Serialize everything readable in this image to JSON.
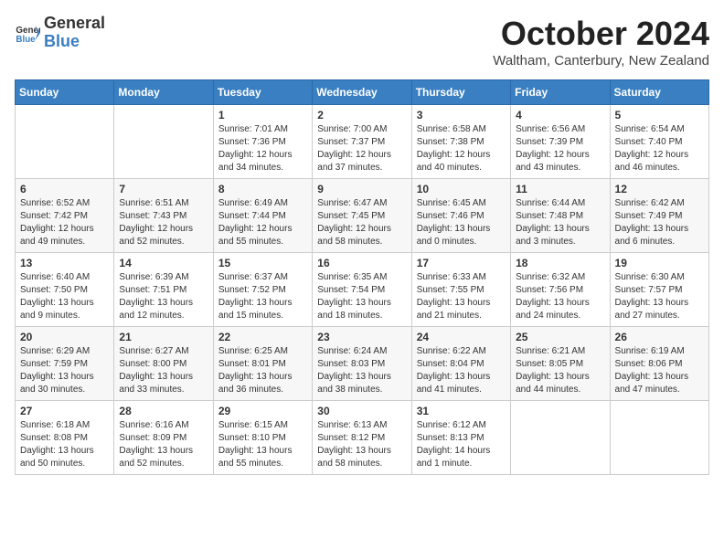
{
  "header": {
    "logo_general": "General",
    "logo_blue": "Blue",
    "month_title": "October 2024",
    "location": "Waltham, Canterbury, New Zealand"
  },
  "weekdays": [
    "Sunday",
    "Monday",
    "Tuesday",
    "Wednesday",
    "Thursday",
    "Friday",
    "Saturday"
  ],
  "weeks": [
    [
      {
        "day": "",
        "info": ""
      },
      {
        "day": "",
        "info": ""
      },
      {
        "day": "1",
        "info": "Sunrise: 7:01 AM\nSunset: 7:36 PM\nDaylight: 12 hours\nand 34 minutes."
      },
      {
        "day": "2",
        "info": "Sunrise: 7:00 AM\nSunset: 7:37 PM\nDaylight: 12 hours\nand 37 minutes."
      },
      {
        "day": "3",
        "info": "Sunrise: 6:58 AM\nSunset: 7:38 PM\nDaylight: 12 hours\nand 40 minutes."
      },
      {
        "day": "4",
        "info": "Sunrise: 6:56 AM\nSunset: 7:39 PM\nDaylight: 12 hours\nand 43 minutes."
      },
      {
        "day": "5",
        "info": "Sunrise: 6:54 AM\nSunset: 7:40 PM\nDaylight: 12 hours\nand 46 minutes."
      }
    ],
    [
      {
        "day": "6",
        "info": "Sunrise: 6:52 AM\nSunset: 7:42 PM\nDaylight: 12 hours\nand 49 minutes."
      },
      {
        "day": "7",
        "info": "Sunrise: 6:51 AM\nSunset: 7:43 PM\nDaylight: 12 hours\nand 52 minutes."
      },
      {
        "day": "8",
        "info": "Sunrise: 6:49 AM\nSunset: 7:44 PM\nDaylight: 12 hours\nand 55 minutes."
      },
      {
        "day": "9",
        "info": "Sunrise: 6:47 AM\nSunset: 7:45 PM\nDaylight: 12 hours\nand 58 minutes."
      },
      {
        "day": "10",
        "info": "Sunrise: 6:45 AM\nSunset: 7:46 PM\nDaylight: 13 hours\nand 0 minutes."
      },
      {
        "day": "11",
        "info": "Sunrise: 6:44 AM\nSunset: 7:48 PM\nDaylight: 13 hours\nand 3 minutes."
      },
      {
        "day": "12",
        "info": "Sunrise: 6:42 AM\nSunset: 7:49 PM\nDaylight: 13 hours\nand 6 minutes."
      }
    ],
    [
      {
        "day": "13",
        "info": "Sunrise: 6:40 AM\nSunset: 7:50 PM\nDaylight: 13 hours\nand 9 minutes."
      },
      {
        "day": "14",
        "info": "Sunrise: 6:39 AM\nSunset: 7:51 PM\nDaylight: 13 hours\nand 12 minutes."
      },
      {
        "day": "15",
        "info": "Sunrise: 6:37 AM\nSunset: 7:52 PM\nDaylight: 13 hours\nand 15 minutes."
      },
      {
        "day": "16",
        "info": "Sunrise: 6:35 AM\nSunset: 7:54 PM\nDaylight: 13 hours\nand 18 minutes."
      },
      {
        "day": "17",
        "info": "Sunrise: 6:33 AM\nSunset: 7:55 PM\nDaylight: 13 hours\nand 21 minutes."
      },
      {
        "day": "18",
        "info": "Sunrise: 6:32 AM\nSunset: 7:56 PM\nDaylight: 13 hours\nand 24 minutes."
      },
      {
        "day": "19",
        "info": "Sunrise: 6:30 AM\nSunset: 7:57 PM\nDaylight: 13 hours\nand 27 minutes."
      }
    ],
    [
      {
        "day": "20",
        "info": "Sunrise: 6:29 AM\nSunset: 7:59 PM\nDaylight: 13 hours\nand 30 minutes."
      },
      {
        "day": "21",
        "info": "Sunrise: 6:27 AM\nSunset: 8:00 PM\nDaylight: 13 hours\nand 33 minutes."
      },
      {
        "day": "22",
        "info": "Sunrise: 6:25 AM\nSunset: 8:01 PM\nDaylight: 13 hours\nand 36 minutes."
      },
      {
        "day": "23",
        "info": "Sunrise: 6:24 AM\nSunset: 8:03 PM\nDaylight: 13 hours\nand 38 minutes."
      },
      {
        "day": "24",
        "info": "Sunrise: 6:22 AM\nSunset: 8:04 PM\nDaylight: 13 hours\nand 41 minutes."
      },
      {
        "day": "25",
        "info": "Sunrise: 6:21 AM\nSunset: 8:05 PM\nDaylight: 13 hours\nand 44 minutes."
      },
      {
        "day": "26",
        "info": "Sunrise: 6:19 AM\nSunset: 8:06 PM\nDaylight: 13 hours\nand 47 minutes."
      }
    ],
    [
      {
        "day": "27",
        "info": "Sunrise: 6:18 AM\nSunset: 8:08 PM\nDaylight: 13 hours\nand 50 minutes."
      },
      {
        "day": "28",
        "info": "Sunrise: 6:16 AM\nSunset: 8:09 PM\nDaylight: 13 hours\nand 52 minutes."
      },
      {
        "day": "29",
        "info": "Sunrise: 6:15 AM\nSunset: 8:10 PM\nDaylight: 13 hours\nand 55 minutes."
      },
      {
        "day": "30",
        "info": "Sunrise: 6:13 AM\nSunset: 8:12 PM\nDaylight: 13 hours\nand 58 minutes."
      },
      {
        "day": "31",
        "info": "Sunrise: 6:12 AM\nSunset: 8:13 PM\nDaylight: 14 hours\nand 1 minute."
      },
      {
        "day": "",
        "info": ""
      },
      {
        "day": "",
        "info": ""
      }
    ]
  ]
}
